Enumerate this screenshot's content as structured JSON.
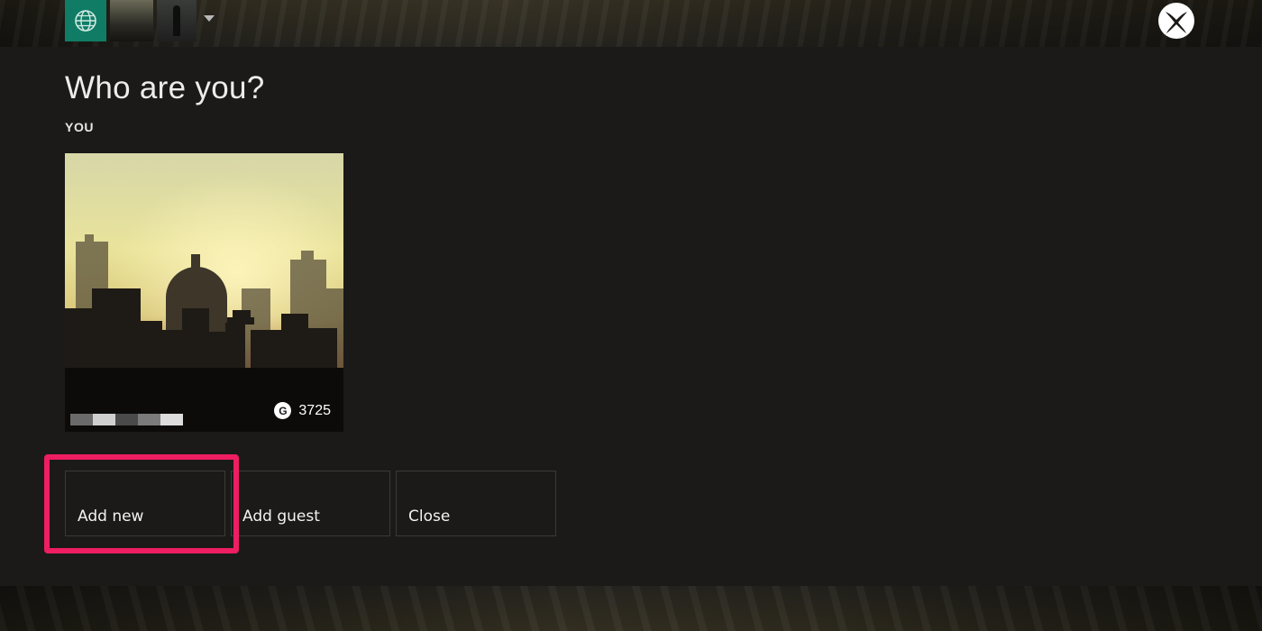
{
  "dialog": {
    "title": "Who are you?",
    "section_label": "YOU"
  },
  "profile": {
    "gamerscore_icon": "G",
    "gamerscore": "3725",
    "gamertag_obscured": true
  },
  "actions": {
    "add_new": "Add new",
    "add_guest": "Add guest",
    "close": "Close"
  },
  "topbar": {
    "tiles": [
      "globe-icon",
      "profile-photo",
      "profile-photo",
      "chevron-down-icon"
    ],
    "logo": "xbox-logo-icon"
  },
  "colors": {
    "accent_tile": "#107c65",
    "highlight": "#ef1d63",
    "background": "#1b1a18"
  }
}
